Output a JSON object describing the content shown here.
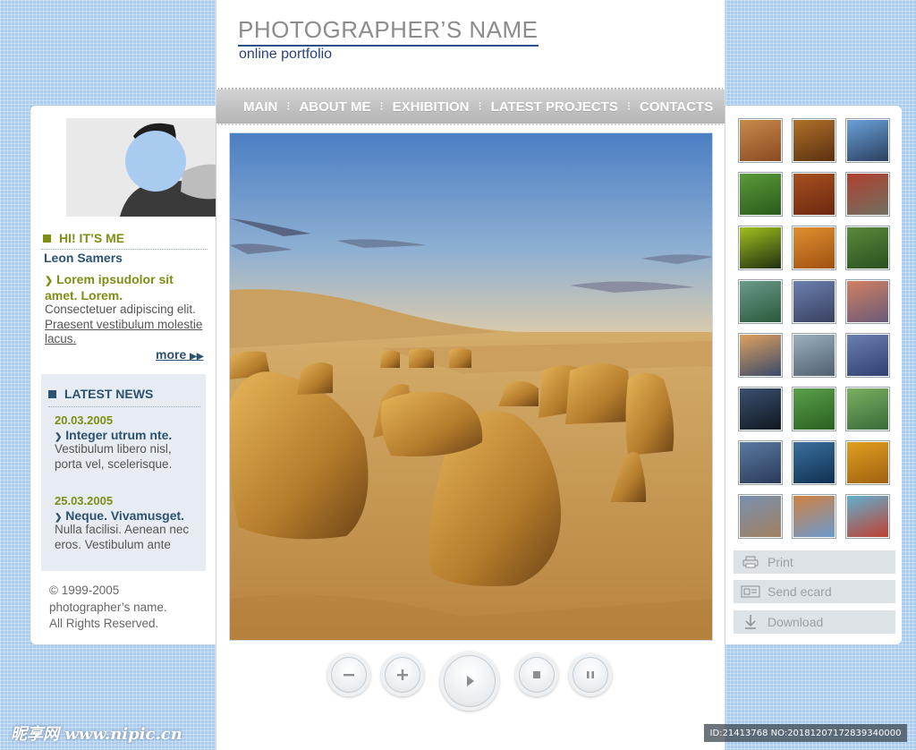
{
  "header": {
    "title": "PHOTOGRAPHER’S NAME",
    "subtitle": "online portfolio"
  },
  "nav": {
    "items": [
      {
        "label": "MAIN"
      },
      {
        "label": "ABOUT ME"
      },
      {
        "label": "EXHIBITION"
      },
      {
        "label": "LATEST PROJECTS"
      },
      {
        "label": "CONTACTS"
      }
    ]
  },
  "about": {
    "title": "HI! IT’S ME",
    "name": "Leon Samers",
    "headline": "Lorem ipsudolor sit amet. Lorem.",
    "text": "Consectetuer adipiscing elit.",
    "link_text": "Praesent vestibulum molestie lacus.",
    "more_label": "more"
  },
  "news": {
    "title": "LATEST NEWS",
    "items": [
      {
        "date": "20.03.2005",
        "headline": "Integer utrum nte.",
        "text": "Vestibulum libero nisl, porta vel, scelerisque."
      },
      {
        "date": "25.03.2005",
        "headline": "Neque. Vivamusget.",
        "text": "Nulla facilisi. Aenean nec eros. Vestibulum ante"
      }
    ]
  },
  "footer": {
    "copyright_line1": "© 1999-2005",
    "copyright_line2": "photographer’s name.",
    "copyright_line3": "All Rights Reserved."
  },
  "gallery": {
    "thumbnails": [
      {
        "name": "desert-dunes",
        "colors": [
          "#c98a4a",
          "#8a4a22"
        ]
      },
      {
        "name": "canyon",
        "colors": [
          "#b0702a",
          "#5a3010"
        ]
      },
      {
        "name": "butterfly",
        "colors": [
          "#6aa0d8",
          "#2a4060"
        ]
      },
      {
        "name": "bamboo",
        "colors": [
          "#5a9a3a",
          "#2a5a1a"
        ]
      },
      {
        "name": "rock-red",
        "colors": [
          "#a85020",
          "#6a2810"
        ]
      },
      {
        "name": "red-flowers",
        "colors": [
          "#b04030",
          "#707060"
        ]
      },
      {
        "name": "green-leaf",
        "colors": [
          "#a0c020",
          "#203010"
        ]
      },
      {
        "name": "orange-sunset",
        "colors": [
          "#e09030",
          "#a05010"
        ]
      },
      {
        "name": "green-macro",
        "colors": [
          "#5a8a3a",
          "#2a5020"
        ]
      },
      {
        "name": "forest",
        "colors": [
          "#6a9a8a",
          "#2a5a3a"
        ]
      },
      {
        "name": "mountain-clouds",
        "colors": [
          "#6a80b0",
          "#3a4060"
        ]
      },
      {
        "name": "harbor-dusk",
        "colors": [
          "#d08060",
          "#6a5a7a"
        ]
      },
      {
        "name": "sailboat-sunset",
        "colors": [
          "#e0a060",
          "#3a4a6a"
        ]
      },
      {
        "name": "lake-mist",
        "colors": [
          "#9ab0c0",
          "#506070"
        ]
      },
      {
        "name": "blue-haze",
        "colors": [
          "#6a80b0",
          "#304070"
        ]
      },
      {
        "name": "night-pier",
        "colors": [
          "#3a5070",
          "#101820"
        ]
      },
      {
        "name": "golf-green",
        "colors": [
          "#5aa04a",
          "#2a6020"
        ]
      },
      {
        "name": "villa",
        "colors": [
          "#7ab060",
          "#3a6a3a"
        ]
      },
      {
        "name": "snow-peaks",
        "colors": [
          "#5a7aa0",
          "#2a3a5a"
        ]
      },
      {
        "name": "waterfall",
        "colors": [
          "#3a70a0",
          "#103050"
        ]
      },
      {
        "name": "sunset-globe",
        "colors": [
          "#e0a020",
          "#a06010"
        ]
      },
      {
        "name": "cloudy-coast",
        "colors": [
          "#7a90b0",
          "#a08060"
        ]
      },
      {
        "name": "dune-sky",
        "colors": [
          "#d08040",
          "#6a9ad0"
        ]
      },
      {
        "name": "lifeguard-tower",
        "colors": [
          "#60b0d0",
          "#c04030"
        ]
      }
    ]
  },
  "actions": {
    "print": "Print",
    "ecard": "Send ecard",
    "download": "Download"
  },
  "watermark": {
    "left": "昵享网 www.nipic.cn",
    "right": "ID:21413768 NO:20181207172839340000"
  }
}
